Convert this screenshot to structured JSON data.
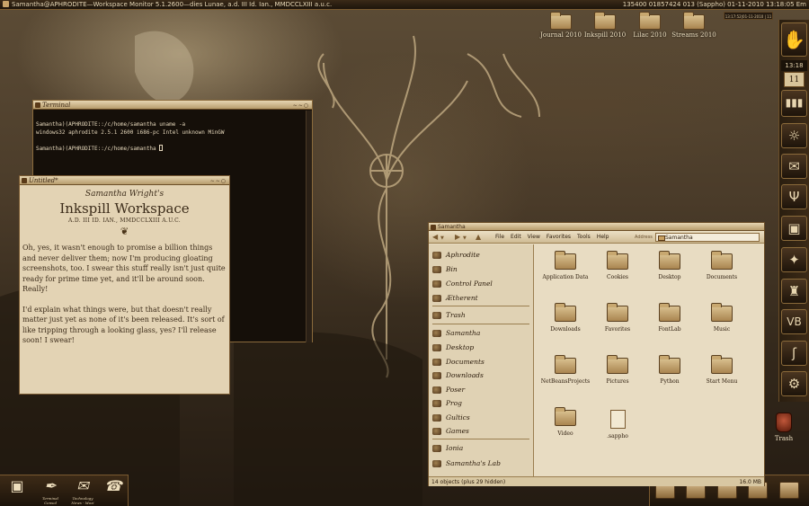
{
  "topbar": {
    "left": "Samantha@APHRODITE—Workspace Monitor 5.1.2600—dies Lunae, a.d. III Id. Ian., MMDCCLXIII a.u.c.",
    "right": "135400 01857424 013 (Sappho) 01-11-2010 13:18:05 Em"
  },
  "desktop_icons": [
    {
      "label": "Journal 2010"
    },
    {
      "label": "Inkspill 2010"
    },
    {
      "label": "Lilac 2010"
    },
    {
      "label": "Streams 2010"
    }
  ],
  "clock_widget": "13:17:52|01-11-2010 | 11",
  "right_dock": {
    "time": "13:18",
    "date": "11",
    "icons": [
      "hand-logo-icon",
      "calendar-icon",
      "bars-icon",
      "globe-icon",
      "mail-icon",
      "psi-icon",
      "monitor-icon",
      "bird-icon",
      "chess-icon",
      "vb-icon",
      "script-s-icon",
      "globe-lock-icon"
    ]
  },
  "desktop_trash": {
    "label": "Trash"
  },
  "bottom_left_dock": [
    {
      "label": ""
    },
    {
      "label": "Terminal Consol"
    },
    {
      "label": "Technology News - Mozi"
    },
    {
      "label": ""
    }
  ],
  "terminal": {
    "title": "Terminal",
    "lines": "Samantha)(APHRODITE::/c/home/samantha uname -a\nwindows32 aphrodite 2.5.1 2600 i686-pc Intel unknown MinGW\n\nSamantha)(APHRODITE::/c/home/samantha "
  },
  "note": {
    "title": "Untitled*",
    "heading_small": "Samantha Wright's",
    "heading_big": "Inkspill Workspace",
    "date": "A.D. III ID. IAN., MMDCCLXIII A.U.C.",
    "flourish": "❦",
    "para1": "Oh, yes, it wasn't enough to promise a billion things and never deliver them; now I'm producing gloating screenshots, too. I swear this stuff really isn't just quite ready for prime time yet, and it'll be around soon. Really!",
    "para2": "I'd explain what things were, but that doesn't really matter just yet as none of it's been released. It's sort of like tripping through a looking glass, yes? I'll release soon! I swear!"
  },
  "file_manager": {
    "title": "Samantha",
    "menu": [
      "File",
      "Edit",
      "View",
      "Favorites",
      "Tools",
      "Help"
    ],
    "address_label": "Address",
    "address": "Samantha",
    "sidebar": [
      {
        "label": "Aphrodite"
      },
      {
        "label": "Bin"
      },
      {
        "label": "Control Panel"
      },
      {
        "label": "Ætherent"
      },
      {
        "label": "Trash"
      },
      {
        "label": "Samantha"
      },
      {
        "label": "Desktop"
      },
      {
        "label": "Documents"
      },
      {
        "label": "Downloads"
      },
      {
        "label": "Poser"
      },
      {
        "label": "Prog"
      },
      {
        "label": "Gultics"
      },
      {
        "label": "Games"
      },
      {
        "label": "Ionia"
      },
      {
        "label": "Samantha's Lab"
      }
    ],
    "items": [
      {
        "label": "Application Data"
      },
      {
        "label": "Cookies"
      },
      {
        "label": "Desktop"
      },
      {
        "label": "Documents"
      },
      {
        "label": "Downloads"
      },
      {
        "label": "Favorites"
      },
      {
        "label": "FontLab"
      },
      {
        "label": "Music"
      },
      {
        "label": "NetBeansProjects"
      },
      {
        "label": "Pictures"
      },
      {
        "label": "Python"
      },
      {
        "label": "Start Menu"
      },
      {
        "label": "Video"
      },
      {
        "label": ".sappho"
      }
    ],
    "status_left": "14 objects (plus 29 hidden)",
    "status_right": "16.0 MB"
  },
  "colors": {
    "accent": "#c9a46a",
    "paper": "#e3d3b4",
    "dark": "#1c140b"
  }
}
